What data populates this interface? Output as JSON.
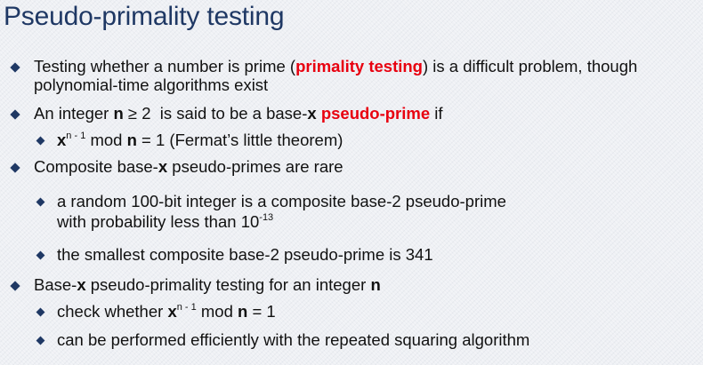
{
  "title": "Pseudo-primality testing",
  "bullets": {
    "b1": {
      "line1_pre": "Testing whether a number is prime (",
      "line1_red": "primality testing",
      "line1_post": ") is a difficult problem, though",
      "line2": "polynomial-time algorithms exist"
    },
    "b2": {
      "pre": "An integer ",
      "n": "n",
      "mid1": " ≥ 2  is said to be a base-",
      "x": "x",
      "sp": " ",
      "red": "pseudo-prime",
      "post": " if"
    },
    "b2_1": {
      "x": "x",
      "sup": "n - 1",
      "mid": " mod ",
      "n": "n",
      "post": " = 1 (Fermat’s little theorem)"
    },
    "b3": {
      "pre": "Composite base-",
      "x": "x",
      "post": " pseudo-primes are rare"
    },
    "b3_1": {
      "line1": "a random 100-bit integer is a composite base-2 pseudo-prime",
      "line2_pre": "with probability less than 10",
      "line2_sup": "-13"
    },
    "b3_2": {
      "text": "the smallest composite base-2 pseudo-prime is 341"
    },
    "b4": {
      "pre": "Base-",
      "x": "x",
      "mid": " pseudo-primality testing for an integer ",
      "n": "n"
    },
    "b4_1": {
      "pre": "check whether ",
      "x": "x",
      "sup": "n - 1",
      "mid": " mod ",
      "n": "n",
      "post": " = 1"
    },
    "b4_2": {
      "text": "can be performed efficiently with the repeated squaring algorithm"
    }
  }
}
